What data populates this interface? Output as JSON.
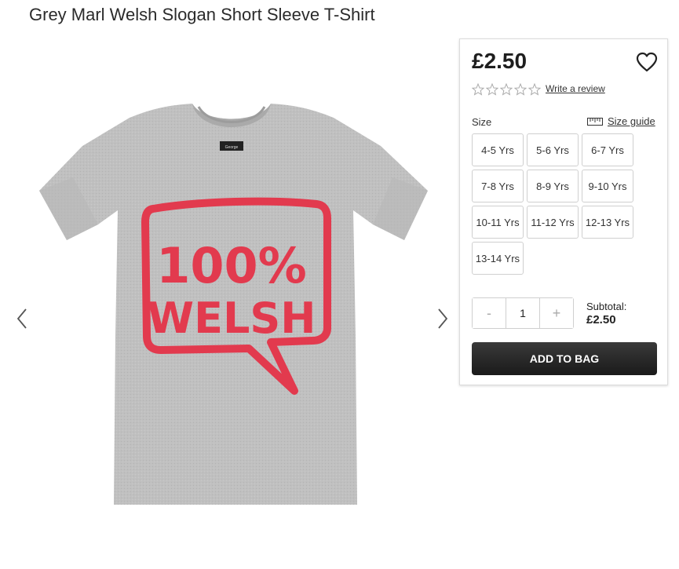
{
  "product": {
    "title": "Grey Marl Welsh Slogan Short Sleeve T-Shirt",
    "image_text": {
      "line1": "100%",
      "line2": "WELSH",
      "neck_label": "George"
    }
  },
  "gallery": {
    "prev_icon": "chevron-left-icon",
    "next_icon": "chevron-right-icon"
  },
  "purchase": {
    "price": "£2.50",
    "wishlist_icon": "heart-icon",
    "rating": {
      "stars_filled": 0,
      "stars_total": 5
    },
    "review_link": "Write a review",
    "size_label": "Size",
    "size_guide_label": "Size guide",
    "size_guide_icon": "ruler-icon",
    "sizes": [
      "4-5 Yrs",
      "5-6 Yrs",
      "6-7 Yrs",
      "7-8 Yrs",
      "8-9 Yrs",
      "9-10 Yrs",
      "10-11 Yrs",
      "11-12 Yrs",
      "12-13 Yrs",
      "13-14 Yrs"
    ],
    "quantity": {
      "minus": "-",
      "value": "1",
      "plus": "+"
    },
    "subtotal_label": "Subtotal:",
    "subtotal_value": "£2.50",
    "add_to_bag": "ADD TO BAG"
  },
  "colors": {
    "accent_red": "#e23a4e",
    "shirt_grey": "#bdbdbd",
    "button_dark": "#2a2a2a"
  }
}
